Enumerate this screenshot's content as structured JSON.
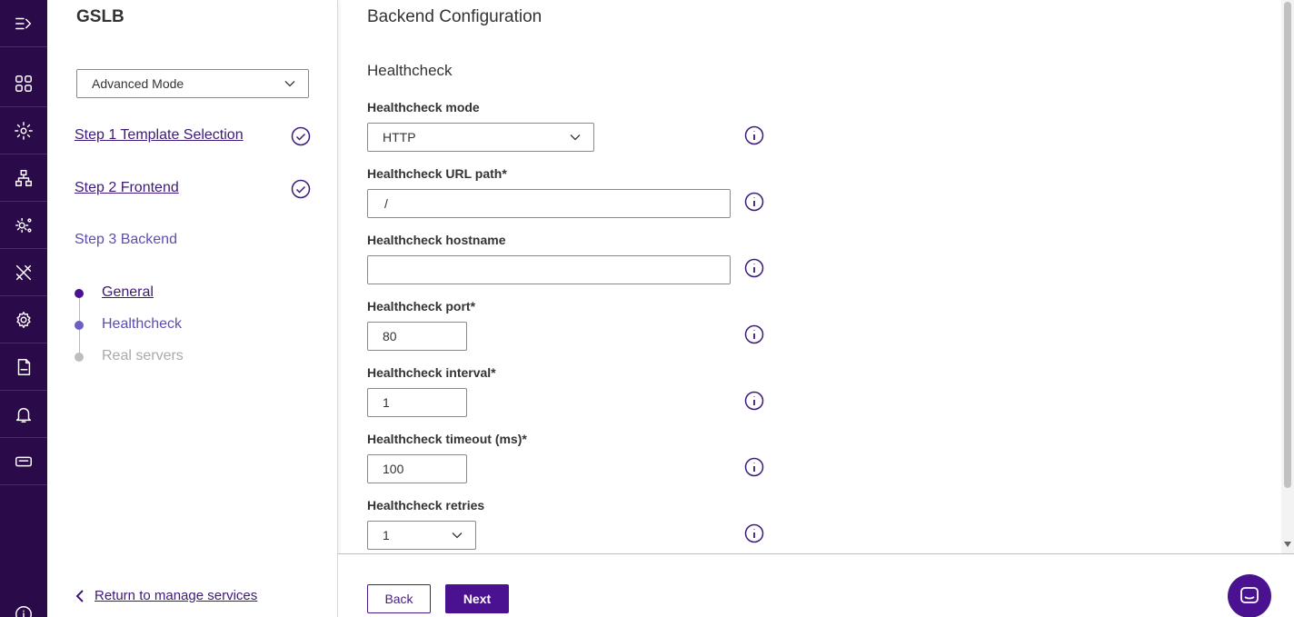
{
  "sidebar": {
    "rail_items": [
      "expand-icon",
      "dashboard-icon",
      "settings-cog-icon",
      "network-icon",
      "services-icon",
      "tools-icon",
      "gear-icon",
      "log-file-icon",
      "bell-icon",
      "ticket-icon",
      "info-icon"
    ]
  },
  "steps_panel": {
    "title": "GSLB",
    "mode_select": "Advanced Mode",
    "step1": "Step 1 Template Selection",
    "step2": "Step 2 Frontend",
    "step3": "Step 3 Backend",
    "sub_general": "General",
    "sub_healthcheck": "Healthcheck",
    "sub_real_servers": "Real servers",
    "return_link": "Return to manage services"
  },
  "main": {
    "page_title": "Backend Configuration",
    "section_title": "Healthcheck",
    "fields": {
      "mode": {
        "label": "Healthcheck mode",
        "value": "HTTP"
      },
      "url_path": {
        "label": "Healthcheck URL path*",
        "value": "/"
      },
      "hostname": {
        "label": "Healthcheck hostname",
        "value": ""
      },
      "port": {
        "label": "Healthcheck port*",
        "value": "80"
      },
      "interval": {
        "label": "Healthcheck interval*",
        "value": "1"
      },
      "timeout": {
        "label": "Healthcheck timeout (ms)*",
        "value": "100"
      },
      "retries": {
        "label": "Healthcheck retries",
        "value": "1"
      }
    }
  },
  "footer": {
    "back_label": "Back",
    "next_label": "Next"
  },
  "colors": {
    "rail_bg": "#2b0a4a",
    "accent": "#4a1290",
    "link": "#3d1a7a",
    "current_step": "#5a4fb0"
  }
}
